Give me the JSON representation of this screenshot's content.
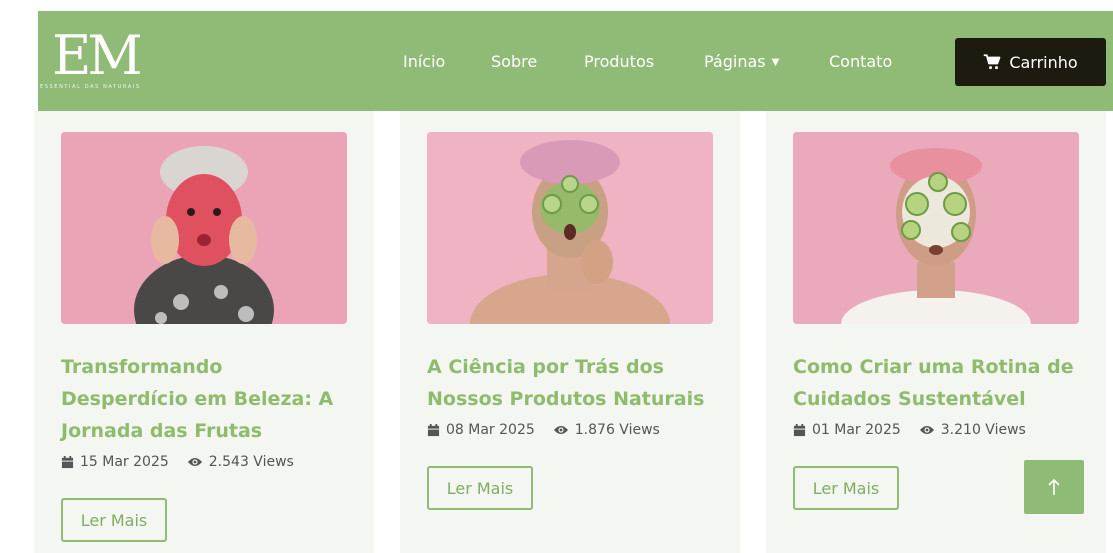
{
  "header": {
    "logo_monogram": "EM",
    "logo_tagline": "ESSENTIAL DAS NATURAIS",
    "nav": {
      "home": "Início",
      "about": "Sobre",
      "products": "Produtos",
      "pages": "Páginas",
      "contact": "Contato"
    },
    "cart_label": "Carrinho"
  },
  "posts": [
    {
      "title": "Transformando Desperdício em Beleza: A Jornada das Frutas",
      "date": "15 Mar 2025",
      "views": "2.543 Views",
      "button": "Ler Mais"
    },
    {
      "title": "A Ciência por Trás dos Nossos Produtos Naturais",
      "date": "08 Mar 2025",
      "views": "1.876 Views",
      "button": "Ler Mais"
    },
    {
      "title": "Como Criar uma Rotina de Cuidados Sustentável",
      "date": "01 Mar 2025",
      "views": "3.210 Views",
      "button": "Ler Mais"
    }
  ],
  "icons": {
    "cart": "cart-icon",
    "calendar": "calendar-icon",
    "eye": "eye-icon",
    "chevron": "chevron-down-icon",
    "arrow_up": "arrow-up-icon"
  },
  "colors": {
    "brand_green": "#90bb76",
    "title_green": "#8fbb6d",
    "cart_dark": "#1d1a0f",
    "card_bg": "#f3f6f1",
    "image_pink": "#e9a4b6"
  }
}
